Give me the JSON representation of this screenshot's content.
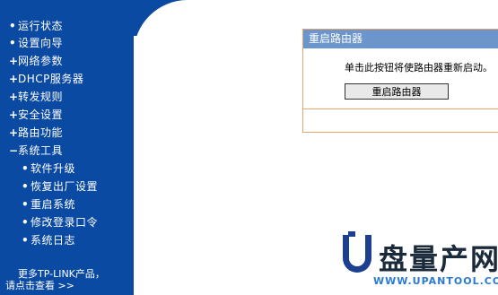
{
  "sidebar": {
    "items": [
      {
        "bullet": "•",
        "label": "运行状态"
      },
      {
        "bullet": "•",
        "label": "设置向导"
      },
      {
        "bullet": "+",
        "label": "网络参数"
      },
      {
        "bullet": "+",
        "label": "DHCP服务器"
      },
      {
        "bullet": "+",
        "label": "转发规则"
      },
      {
        "bullet": "+",
        "label": "安全设置"
      },
      {
        "bullet": "+",
        "label": "路由功能"
      },
      {
        "bullet": "−",
        "label": "系统工具"
      }
    ],
    "subitems": [
      {
        "bullet": "•",
        "label": "软件升级"
      },
      {
        "bullet": "•",
        "label": "恢复出厂设置"
      },
      {
        "bullet": "•",
        "label": "重启系统"
      },
      {
        "bullet": "•",
        "label": "修改登录口令"
      },
      {
        "bullet": "•",
        "label": "系统日志"
      }
    ],
    "more_line1": "更多TP-LINK产品，",
    "more_line2": "请点击查看 >>"
  },
  "panel": {
    "title": "重启路由器",
    "message": "单击此按钮将使路由器重新启动。",
    "button_label": "重启路由器"
  },
  "watermark": {
    "brand": "盘量产网",
    "url": "WWW.UPANTOOL.COM"
  },
  "colors": {
    "sidebar_bg": "#0b4aa3",
    "panel_header": "#6c96cb",
    "panel_border": "#e8a66c"
  }
}
